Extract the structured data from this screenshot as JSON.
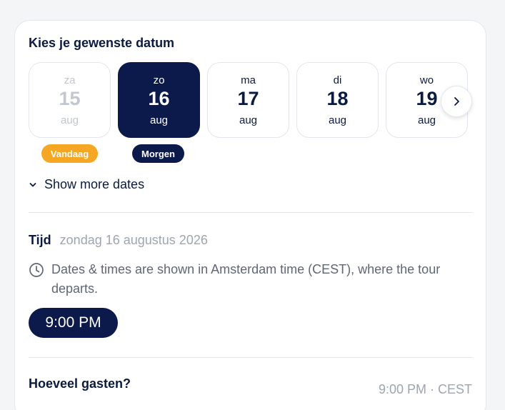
{
  "heading": "Kies je gewenste datum",
  "dates": [
    {
      "dow": "za",
      "day": "15",
      "month": "aug",
      "state": "disabled"
    },
    {
      "dow": "zo",
      "day": "16",
      "month": "aug",
      "state": "selected"
    },
    {
      "dow": "ma",
      "day": "17",
      "month": "aug",
      "state": "normal"
    },
    {
      "dow": "di",
      "day": "18",
      "month": "aug",
      "state": "normal"
    },
    {
      "dow": "wo",
      "day": "19",
      "month": "aug",
      "state": "normal"
    }
  ],
  "badges": {
    "today": "Vandaag",
    "tomorrow": "Morgen"
  },
  "show_more": "Show more dates",
  "time_section": {
    "label": "Tijd",
    "date_text": "zondag 16 augustus 2026",
    "timezone_note": "Dates & times are shown in Amsterdam time (CEST), where the tour departs.",
    "slot": "9:00 PM"
  },
  "guests": {
    "title": "Hoeveel gasten?",
    "time_summary": "9:00 PM · CEST"
  },
  "colors": {
    "navy": "#0b1a4a",
    "orange": "#f5a623",
    "muted": "#9ea4b0"
  },
  "icons": {
    "next": "chevron-right-icon",
    "expand": "chevron-down-icon",
    "clock": "clock-icon"
  }
}
